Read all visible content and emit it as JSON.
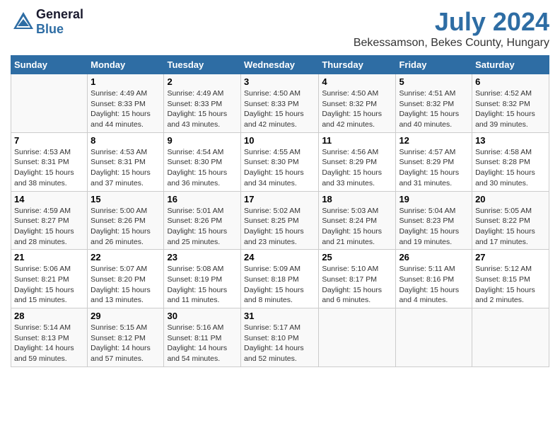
{
  "header": {
    "logo": {
      "general": "General",
      "blue": "Blue"
    },
    "title": "July 2024",
    "location": "Bekessamson, Bekes County, Hungary"
  },
  "days_of_week": [
    "Sunday",
    "Monday",
    "Tuesday",
    "Wednesday",
    "Thursday",
    "Friday",
    "Saturday"
  ],
  "weeks": [
    [
      {
        "num": "",
        "info": ""
      },
      {
        "num": "1",
        "info": "Sunrise: 4:49 AM\nSunset: 8:33 PM\nDaylight: 15 hours\nand 44 minutes."
      },
      {
        "num": "2",
        "info": "Sunrise: 4:49 AM\nSunset: 8:33 PM\nDaylight: 15 hours\nand 43 minutes."
      },
      {
        "num": "3",
        "info": "Sunrise: 4:50 AM\nSunset: 8:33 PM\nDaylight: 15 hours\nand 42 minutes."
      },
      {
        "num": "4",
        "info": "Sunrise: 4:50 AM\nSunset: 8:32 PM\nDaylight: 15 hours\nand 42 minutes."
      },
      {
        "num": "5",
        "info": "Sunrise: 4:51 AM\nSunset: 8:32 PM\nDaylight: 15 hours\nand 40 minutes."
      },
      {
        "num": "6",
        "info": "Sunrise: 4:52 AM\nSunset: 8:32 PM\nDaylight: 15 hours\nand 39 minutes."
      }
    ],
    [
      {
        "num": "7",
        "info": "Sunrise: 4:53 AM\nSunset: 8:31 PM\nDaylight: 15 hours\nand 38 minutes."
      },
      {
        "num": "8",
        "info": "Sunrise: 4:53 AM\nSunset: 8:31 PM\nDaylight: 15 hours\nand 37 minutes."
      },
      {
        "num": "9",
        "info": "Sunrise: 4:54 AM\nSunset: 8:30 PM\nDaylight: 15 hours\nand 36 minutes."
      },
      {
        "num": "10",
        "info": "Sunrise: 4:55 AM\nSunset: 8:30 PM\nDaylight: 15 hours\nand 34 minutes."
      },
      {
        "num": "11",
        "info": "Sunrise: 4:56 AM\nSunset: 8:29 PM\nDaylight: 15 hours\nand 33 minutes."
      },
      {
        "num": "12",
        "info": "Sunrise: 4:57 AM\nSunset: 8:29 PM\nDaylight: 15 hours\nand 31 minutes."
      },
      {
        "num": "13",
        "info": "Sunrise: 4:58 AM\nSunset: 8:28 PM\nDaylight: 15 hours\nand 30 minutes."
      }
    ],
    [
      {
        "num": "14",
        "info": "Sunrise: 4:59 AM\nSunset: 8:27 PM\nDaylight: 15 hours\nand 28 minutes."
      },
      {
        "num": "15",
        "info": "Sunrise: 5:00 AM\nSunset: 8:26 PM\nDaylight: 15 hours\nand 26 minutes."
      },
      {
        "num": "16",
        "info": "Sunrise: 5:01 AM\nSunset: 8:26 PM\nDaylight: 15 hours\nand 25 minutes."
      },
      {
        "num": "17",
        "info": "Sunrise: 5:02 AM\nSunset: 8:25 PM\nDaylight: 15 hours\nand 23 minutes."
      },
      {
        "num": "18",
        "info": "Sunrise: 5:03 AM\nSunset: 8:24 PM\nDaylight: 15 hours\nand 21 minutes."
      },
      {
        "num": "19",
        "info": "Sunrise: 5:04 AM\nSunset: 8:23 PM\nDaylight: 15 hours\nand 19 minutes."
      },
      {
        "num": "20",
        "info": "Sunrise: 5:05 AM\nSunset: 8:22 PM\nDaylight: 15 hours\nand 17 minutes."
      }
    ],
    [
      {
        "num": "21",
        "info": "Sunrise: 5:06 AM\nSunset: 8:21 PM\nDaylight: 15 hours\nand 15 minutes."
      },
      {
        "num": "22",
        "info": "Sunrise: 5:07 AM\nSunset: 8:20 PM\nDaylight: 15 hours\nand 13 minutes."
      },
      {
        "num": "23",
        "info": "Sunrise: 5:08 AM\nSunset: 8:19 PM\nDaylight: 15 hours\nand 11 minutes."
      },
      {
        "num": "24",
        "info": "Sunrise: 5:09 AM\nSunset: 8:18 PM\nDaylight: 15 hours\nand 8 minutes."
      },
      {
        "num": "25",
        "info": "Sunrise: 5:10 AM\nSunset: 8:17 PM\nDaylight: 15 hours\nand 6 minutes."
      },
      {
        "num": "26",
        "info": "Sunrise: 5:11 AM\nSunset: 8:16 PM\nDaylight: 15 hours\nand 4 minutes."
      },
      {
        "num": "27",
        "info": "Sunrise: 5:12 AM\nSunset: 8:15 PM\nDaylight: 15 hours\nand 2 minutes."
      }
    ],
    [
      {
        "num": "28",
        "info": "Sunrise: 5:14 AM\nSunset: 8:13 PM\nDaylight: 14 hours\nand 59 minutes."
      },
      {
        "num": "29",
        "info": "Sunrise: 5:15 AM\nSunset: 8:12 PM\nDaylight: 14 hours\nand 57 minutes."
      },
      {
        "num": "30",
        "info": "Sunrise: 5:16 AM\nSunset: 8:11 PM\nDaylight: 14 hours\nand 54 minutes."
      },
      {
        "num": "31",
        "info": "Sunrise: 5:17 AM\nSunset: 8:10 PM\nDaylight: 14 hours\nand 52 minutes."
      },
      {
        "num": "",
        "info": ""
      },
      {
        "num": "",
        "info": ""
      },
      {
        "num": "",
        "info": ""
      }
    ]
  ]
}
